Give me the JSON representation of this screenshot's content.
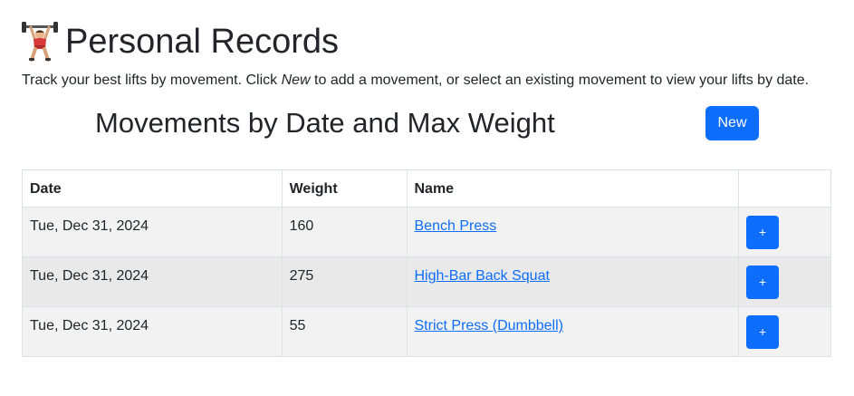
{
  "header": {
    "title_icon": "weightlifter-icon",
    "title": "Personal Records"
  },
  "intro": {
    "before": "Track your best lifts by movement. Click ",
    "emphasis": "New",
    "after": " to add a movement, or select an existing movement to view your lifts by date."
  },
  "section": {
    "title": "Movements by Date and Max Weight",
    "new_button": "New"
  },
  "table": {
    "headers": [
      "Date",
      "Weight",
      "Name",
      ""
    ],
    "rows": [
      {
        "date": "Tue, Dec 31, 2024",
        "weight": "160",
        "name": "Bench Press",
        "action": "+"
      },
      {
        "date": "Tue, Dec 31, 2024",
        "weight": "275",
        "name": "High-Bar Back Squat",
        "action": "+"
      },
      {
        "date": "Tue, Dec 31, 2024",
        "weight": "55",
        "name": "Strict Press (Dumbbell)",
        "action": "+"
      }
    ]
  },
  "colors": {
    "primary": "#0d6efd",
    "row_odd": "#f2f2f2",
    "row_even": "#e9e9e9",
    "border": "#dee2e6"
  }
}
